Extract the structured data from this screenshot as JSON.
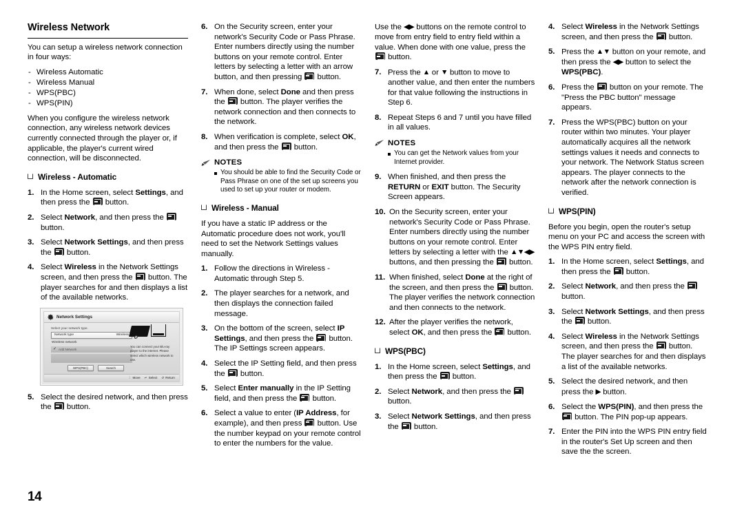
{
  "page": {
    "number": "14"
  },
  "col1": {
    "title": "Wireless Network",
    "intro": "You can setup a wireless network connection in four ways:",
    "ways": [
      "Wireless Automatic",
      "Wireless Manual",
      "WPS(PBC)",
      "WPS(PIN)"
    ],
    "note_paragraph": "When you configure the wireless network connection, any wireless network devices currently connected through the player or, if applicable, the player's current wired connection, will be disconnected.",
    "subhead": "Wireless - Automatic",
    "steps": [
      {
        "num": "1.",
        "parts": [
          {
            "t": "In the Home screen, select "
          },
          {
            "t": "Settings",
            "b": true
          },
          {
            "t": ", and then press the "
          },
          {
            "icon": "enter-key"
          },
          {
            "t": " button."
          }
        ]
      },
      {
        "num": "2.",
        "parts": [
          {
            "t": "Select "
          },
          {
            "t": "Network",
            "b": true
          },
          {
            "t": ", and then press the "
          },
          {
            "icon": "enter-key"
          },
          {
            "t": " button."
          }
        ]
      },
      {
        "num": "3.",
        "parts": [
          {
            "t": "Select "
          },
          {
            "t": "Network Settings",
            "b": true
          },
          {
            "t": ", and then press the "
          },
          {
            "icon": "enter-key"
          },
          {
            "t": " button."
          }
        ]
      },
      {
        "num": "4.",
        "parts": [
          {
            "t": "Select "
          },
          {
            "t": "Wireless",
            "b": true
          },
          {
            "t": " in the Network Settings screen, and then press the "
          },
          {
            "icon": "enter-key"
          },
          {
            "t": " button. The player searches for and then displays a list of the available networks."
          }
        ]
      }
    ],
    "step5": {
      "num": "5.",
      "parts": [
        {
          "t": "Select the desired network, and then press the "
        },
        {
          "icon": "enter-key"
        },
        {
          "t": " button."
        }
      ]
    }
  },
  "screenshot": {
    "title": "Network Settings",
    "prompt": "Select your network type.",
    "row_label": "Network type",
    "row_value": "Wireless",
    "sub_label": "Wireless network",
    "item_label": "Add Network",
    "description": "You can connect your Blu-ray player to the internet. Please select which wireless network to use.",
    "buttons": [
      "WPS(PBC)",
      "Search"
    ],
    "footer": [
      "Move",
      "Select",
      "Return"
    ]
  },
  "col2": {
    "steps": [
      {
        "num": "6.",
        "parts": [
          {
            "t": "On the Security screen, enter your network's Security Code or Pass Phrase. Enter numbers directly using the number buttons on your remote control. Enter letters by selecting a letter with an arrow button, and then pressing "
          },
          {
            "icon": "enter-key"
          },
          {
            "t": " button."
          }
        ]
      },
      {
        "num": "7.",
        "parts": [
          {
            "t": "When done, select "
          },
          {
            "t": "Done",
            "b": true
          },
          {
            "t": " and then press the "
          },
          {
            "icon": "enter-key"
          },
          {
            "t": " button. The player verifies the network connection and then connects to the network."
          }
        ]
      },
      {
        "num": "8.",
        "parts": [
          {
            "t": "When verification is complete, select "
          },
          {
            "t": "OK",
            "b": true
          },
          {
            "t": ", and then press the "
          },
          {
            "icon": "enter-key"
          },
          {
            "t": " button."
          }
        ]
      }
    ],
    "notes_title": "NOTES",
    "notes": [
      "You should be able to find the Security Code or Pass Phrase on one of the set up screens you used to set up your router or modem."
    ],
    "subhead": "Wireless - Manual",
    "manual_intro": "If you have a static IP address or the Automatic procedure does not work, you'll need to set the Network Settings values manually.",
    "manual_steps": [
      {
        "num": "1.",
        "parts": [
          {
            "t": "Follow the directions in Wireless - Automatic through Step 5."
          }
        ]
      },
      {
        "num": "2.",
        "parts": [
          {
            "t": "The player searches for a network, and then displays the connection failed message."
          }
        ]
      },
      {
        "num": "3.",
        "parts": [
          {
            "t": "On the bottom of the screen, select "
          },
          {
            "t": "IP Settings",
            "b": true
          },
          {
            "t": ", and then press the "
          },
          {
            "icon": "enter-key"
          },
          {
            "t": " button. The IP Settings screen appears."
          }
        ]
      },
      {
        "num": "4.",
        "parts": [
          {
            "t": "Select the IP Setting field, and then press the "
          },
          {
            "icon": "enter-key"
          },
          {
            "t": " button."
          }
        ]
      },
      {
        "num": "5.",
        "parts": [
          {
            "t": "Select "
          },
          {
            "t": "Enter manually",
            "b": true
          },
          {
            "t": " in the IP Setting field, and then press the "
          },
          {
            "icon": "enter-key"
          },
          {
            "t": " button."
          }
        ]
      },
      {
        "num": "6.",
        "parts": [
          {
            "t": "Select a value to enter ("
          },
          {
            "t": "IP Address",
            "b": true
          },
          {
            "t": ", for example), and then press "
          },
          {
            "icon": "enter-key"
          },
          {
            "t": " button. Use the number keypad on your remote control to enter the numbers for the value."
          }
        ]
      }
    ]
  },
  "col3": {
    "cont_paragraph": [
      {
        "t": "Use the "
      },
      {
        "icon": "arrows-lr"
      },
      {
        "t": " buttons on the remote control to move from entry field to entry field within a value. When done with one value, press the "
      },
      {
        "icon": "enter-key"
      },
      {
        "t": " button."
      }
    ],
    "steps": [
      {
        "num": "7.",
        "parts": [
          {
            "t": "Press the "
          },
          {
            "icon": "arrow-up"
          },
          {
            "t": " or "
          },
          {
            "icon": "arrow-down"
          },
          {
            "t": " button to move to another value, and then enter the numbers for that value following the instructions in Step 6."
          }
        ]
      },
      {
        "num": "8.",
        "parts": [
          {
            "t": "Repeat Steps 6 and 7 until you have filled in all values."
          }
        ]
      }
    ],
    "notes_title": "NOTES",
    "notes": [
      "You can get the Network values from your Internet provider."
    ],
    "steps2": [
      {
        "num": "9.",
        "parts": [
          {
            "t": "When finished, and then press the "
          },
          {
            "t": "RETURN",
            "b": true
          },
          {
            "t": " or "
          },
          {
            "t": "EXIT",
            "b": true
          },
          {
            "t": " button. The Security Screen appears."
          }
        ]
      },
      {
        "num": "10.",
        "parts": [
          {
            "t": "On the Security screen, enter your network's Security Code or Pass Phrase. Enter numbers directly using the number buttons on your remote control. Enter letters by selecting a letter with the "
          },
          {
            "icon": "arrows-udlr"
          },
          {
            "t": " buttons, and then pressing the "
          },
          {
            "icon": "enter-key"
          },
          {
            "t": " button."
          }
        ]
      },
      {
        "num": "11.",
        "parts": [
          {
            "t": "When finished, select "
          },
          {
            "t": "Done",
            "b": true
          },
          {
            "t": " at the right of the screen, and then press the "
          },
          {
            "icon": "enter-key"
          },
          {
            "t": " button. The player verifies the network connection and then connects to the network."
          }
        ]
      },
      {
        "num": "12.",
        "parts": [
          {
            "t": "After the player verifies the network, select "
          },
          {
            "t": "OK",
            "b": true
          },
          {
            "t": ", and then press the "
          },
          {
            "icon": "enter-key"
          },
          {
            "t": " button."
          }
        ]
      }
    ],
    "subhead": "WPS(PBC)",
    "wps_steps": [
      {
        "num": "1.",
        "parts": [
          {
            "t": "In the Home screen, select "
          },
          {
            "t": "Settings",
            "b": true
          },
          {
            "t": ", and then press the "
          },
          {
            "icon": "enter-key"
          },
          {
            "t": " button."
          }
        ]
      },
      {
        "num": "2.",
        "parts": [
          {
            "t": "Select "
          },
          {
            "t": "Network",
            "b": true
          },
          {
            "t": ", and then press the "
          },
          {
            "icon": "enter-key"
          },
          {
            "t": " button."
          }
        ]
      },
      {
        "num": "3.",
        "parts": [
          {
            "t": "Select "
          },
          {
            "t": "Network Settings",
            "b": true
          },
          {
            "t": ", and then press the "
          },
          {
            "icon": "enter-key"
          },
          {
            "t": " button."
          }
        ]
      }
    ]
  },
  "col4": {
    "steps": [
      {
        "num": "4.",
        "parts": [
          {
            "t": "Select "
          },
          {
            "t": "Wireless",
            "b": true
          },
          {
            "t": " in the Network Settings screen, and then press the "
          },
          {
            "icon": "enter-key"
          },
          {
            "t": " button."
          }
        ]
      },
      {
        "num": "5.",
        "parts": [
          {
            "t": "Press the "
          },
          {
            "icon": "arrows-ud"
          },
          {
            "t": " button on your remote, and then press the "
          },
          {
            "icon": "arrows-lr"
          },
          {
            "t": " button to select the "
          },
          {
            "t": "WPS(PBC)",
            "b": true
          },
          {
            "t": "."
          }
        ]
      },
      {
        "num": "6.",
        "parts": [
          {
            "t": "Press the "
          },
          {
            "icon": "enter-key"
          },
          {
            "t": " button on your remote. The \"Press the PBC button\" message appears."
          }
        ]
      },
      {
        "num": "7.",
        "parts": [
          {
            "t": "Press the WPS(PBC) button on your router within two minutes. Your player automatically acquires all the network settings values it needs and connects to your network.\nThe Network Status screen appears. The player connects to the network after the network connection is verified."
          }
        ]
      }
    ],
    "subhead": "WPS(PIN)",
    "pin_intro": "Before you begin, open the router's setup menu on your PC and access the screen with the WPS PIN entry field.",
    "pin_steps": [
      {
        "num": "1.",
        "parts": [
          {
            "t": "In the Home screen, select "
          },
          {
            "t": "Settings",
            "b": true
          },
          {
            "t": ", and then press the "
          },
          {
            "icon": "enter-key"
          },
          {
            "t": " button."
          }
        ]
      },
      {
        "num": "2.",
        "parts": [
          {
            "t": "Select "
          },
          {
            "t": "Network",
            "b": true
          },
          {
            "t": ", and then press the "
          },
          {
            "icon": "enter-key"
          },
          {
            "t": " button."
          }
        ]
      },
      {
        "num": "3.",
        "parts": [
          {
            "t": "Select "
          },
          {
            "t": "Network Settings",
            "b": true
          },
          {
            "t": ", and then press the "
          },
          {
            "icon": "enter-key"
          },
          {
            "t": " button."
          }
        ]
      },
      {
        "num": "4.",
        "parts": [
          {
            "t": "Select "
          },
          {
            "t": "Wireless",
            "b": true
          },
          {
            "t": " in the Network Settings screen, and then press the "
          },
          {
            "icon": "enter-key"
          },
          {
            "t": " button. The player searches for and then displays a list of the available networks."
          }
        ]
      },
      {
        "num": "5.",
        "parts": [
          {
            "t": "Select the desired network, and then press the "
          },
          {
            "icon": "arrow-right"
          },
          {
            "t": " button."
          }
        ]
      },
      {
        "num": "6.",
        "parts": [
          {
            "t": "Select the "
          },
          {
            "t": "WPS(PIN)",
            "b": true
          },
          {
            "t": ", and then press the "
          },
          {
            "icon": "enter-key"
          },
          {
            "t": " button. The PIN pop-up appears."
          }
        ]
      },
      {
        "num": "7.",
        "parts": [
          {
            "t": "Enter the PIN into the WPS PIN entry field in the router's Set Up screen and then save the the screen."
          }
        ]
      }
    ]
  }
}
